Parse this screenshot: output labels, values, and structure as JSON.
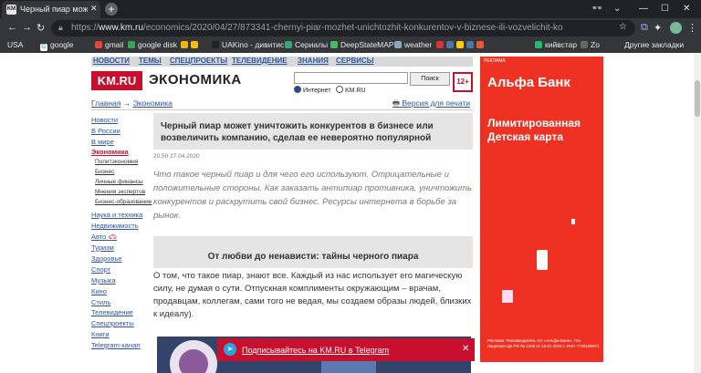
{
  "browser": {
    "tab_title": "Черный пиар может у",
    "tab_favicon": "KM",
    "url_host": "www.km.ru",
    "url_prefix": "https://",
    "url_path": "/economics/2020/04/27/873341-chernyi-piar-mozhet-unichtozhit-konkurentov-v-biznese-ili-vozvelichit-ko",
    "bookmarks": [
      "USA",
      "google",
      "gmail",
      "google disk",
      "UAKino - дивитис",
      "Сериалы",
      "DeepStateMAP",
      "weather",
      "кийвстар",
      "Zo"
    ],
    "other_bookmarks": "Другие закладки"
  },
  "site": {
    "nav": [
      "НОВОСТИ",
      "ТЕМЫ",
      "СПЕЦПРОЕКТЫ",
      "ТЕЛЕВИДЕНИЕ",
      "ЗНАНИЯ",
      "СЕРВИСЫ"
    ],
    "logo": "KM.RU",
    "section": "ЭКОНОМИКА",
    "search_button": "Поиск",
    "radio_internet": "Интернет",
    "radio_kmru": "KM.RU",
    "age_badge": "12+",
    "breadcrumb_home": "Главная",
    "breadcrumb_sep": "→",
    "breadcrumb_section": "Экономика",
    "print_link": "Версия для печати"
  },
  "sidebar": {
    "items": [
      "Новости",
      "В России",
      "В мире",
      "Экономика",
      "Политэкономия",
      "Бизнес",
      "Личные финансы",
      "Мнения экспертов",
      "Бизнес-образование",
      "Наука и техника",
      "Недвижимость",
      "Авто",
      "Туризм",
      "Здоровье",
      "Спорт",
      "Музыка",
      "Кино",
      "Стиль",
      "Телевидение",
      "Спецпроекты",
      "Книги",
      "Telegram-канал"
    ]
  },
  "article": {
    "headline": "Черный пиар может уничтожить конкурентов в бизнесе или возвеличить компанию, сделав ее невероятно популярной",
    "date": "20:50 27.04.2020",
    "lead": "Что такое черный пиар и для чего его используют. Отрицательные и положительные стороны. Как заказать антипиар противника, уничтожить конкурентов и раскрутить свой бизнес. Ресурсы интернета в борьбе за рынок.",
    "subhead": "От любви до ненависти: тайны черного пиара",
    "body": "О том, что такое пиар, знают все. Каждый из нас использует его магическую силу, не думая о сути. Отпускная комплименты окружающим – врачам, продавцам, коллегам, сами того не ведая, мы создаем образы людей, близких к идеалу)."
  },
  "telegram": {
    "text": "Подписывайтесь на KM.RU в Telegram",
    "close": "✕"
  },
  "ad": {
    "label": "РЕКЛАМА",
    "brand": "Альфа Банк",
    "headline": "Лимитированная Детская карта",
    "legal": "Реклама. Рекламодатель АО «Альфа-Банк». Ген. лицензия ЦБ РФ № 1326 от 16.01.2015 г. ИНН 7728168971"
  },
  "colors": {
    "brand_red": "#c8102e",
    "link_blue": "#2a56a4",
    "ad_red": "#ef3124"
  }
}
